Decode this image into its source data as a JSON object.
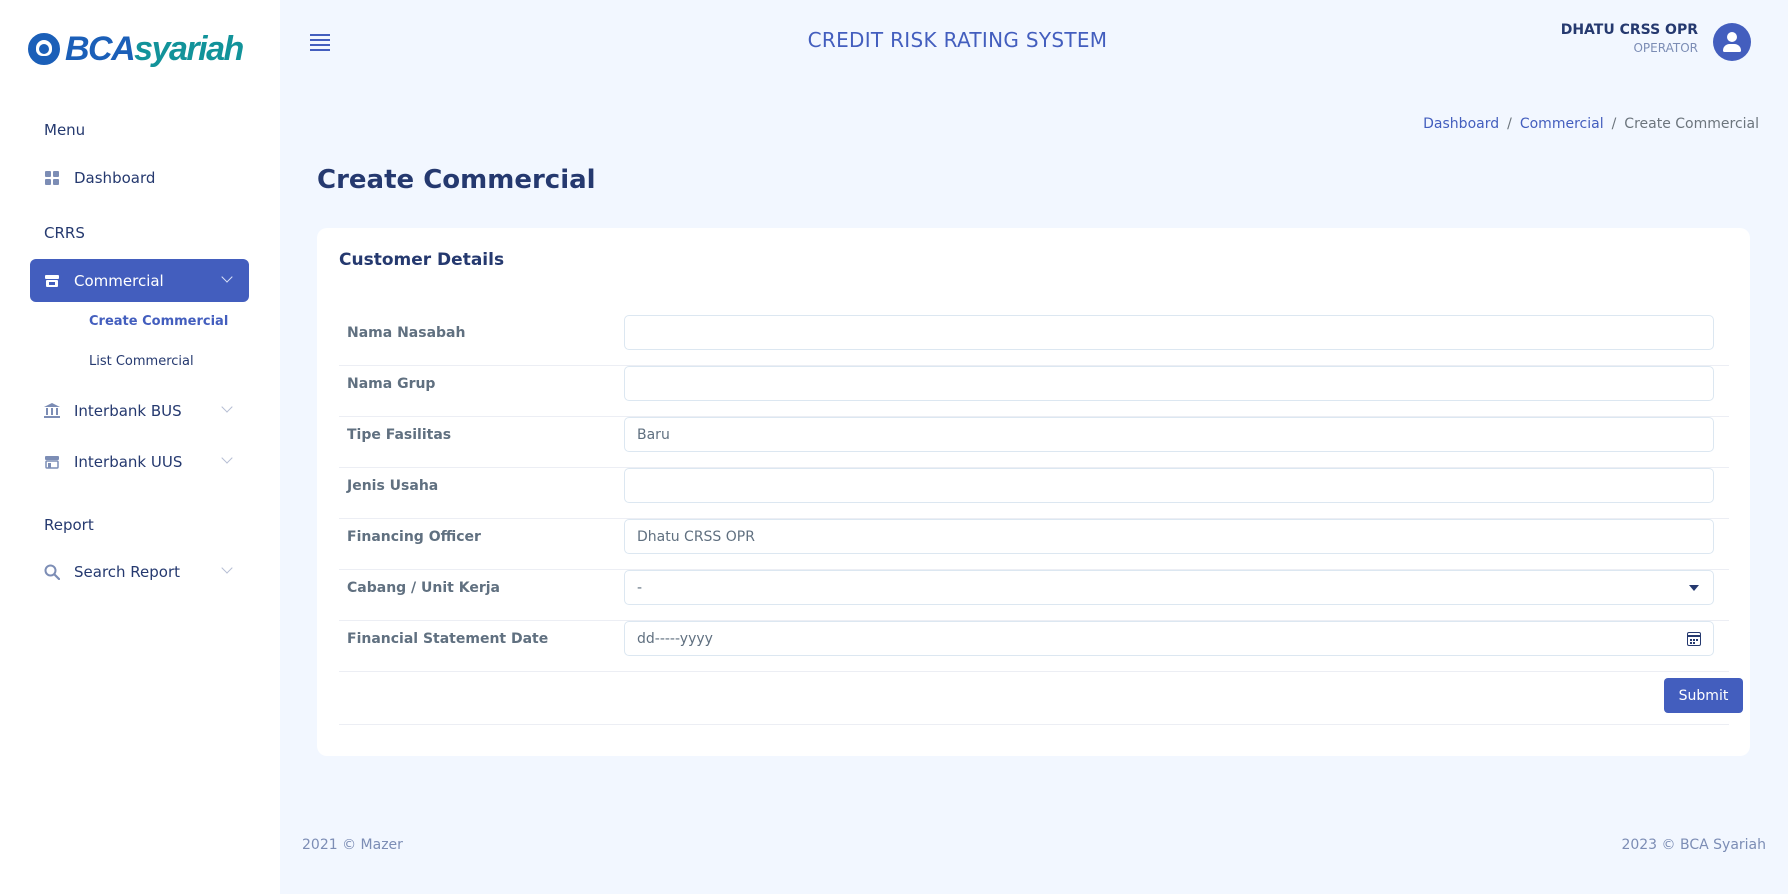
{
  "brand": {
    "part1": "BCA",
    "part2": "syariah"
  },
  "header": {
    "title": "CREDIT RISK RATING SYSTEM",
    "user_name": "DHATU CRSS OPR",
    "user_role": "OPERATOR"
  },
  "sidebar": {
    "section_menu": "Menu",
    "dashboard": "Dashboard",
    "section_crrs": "CRRS",
    "commercial": "Commercial",
    "create_commercial": "Create Commercial",
    "list_commercial": "List Commercial",
    "interbank_bus": "Interbank BUS",
    "interbank_uus": "Interbank UUS",
    "section_report": "Report",
    "search_report": "Search Report"
  },
  "breadcrumb": [
    "Dashboard",
    "Commercial",
    "Create Commercial"
  ],
  "page_title": "Create Commercial",
  "form": {
    "card_title": "Customer Details",
    "fields": [
      {
        "label": "Nama Nasabah",
        "value": ""
      },
      {
        "label": "Nama Grup",
        "value": ""
      },
      {
        "label": "Tipe Fasilitas",
        "value": "Baru"
      },
      {
        "label": "Jenis Usaha",
        "value": ""
      },
      {
        "label": "Financing Officer",
        "value": "Dhatu CRSS OPR"
      },
      {
        "label": "Cabang / Unit Kerja",
        "value": "-"
      },
      {
        "label": "Financial Statement Date",
        "value": "dd-----yyyy"
      }
    ],
    "submit_label": "Submit"
  },
  "footer": {
    "left": "2021 © Mazer",
    "right": "2023 © BCA Syariah"
  },
  "colors": {
    "primary": "#435ebe",
    "text": "#25396f",
    "background": "#f2f7ff"
  }
}
